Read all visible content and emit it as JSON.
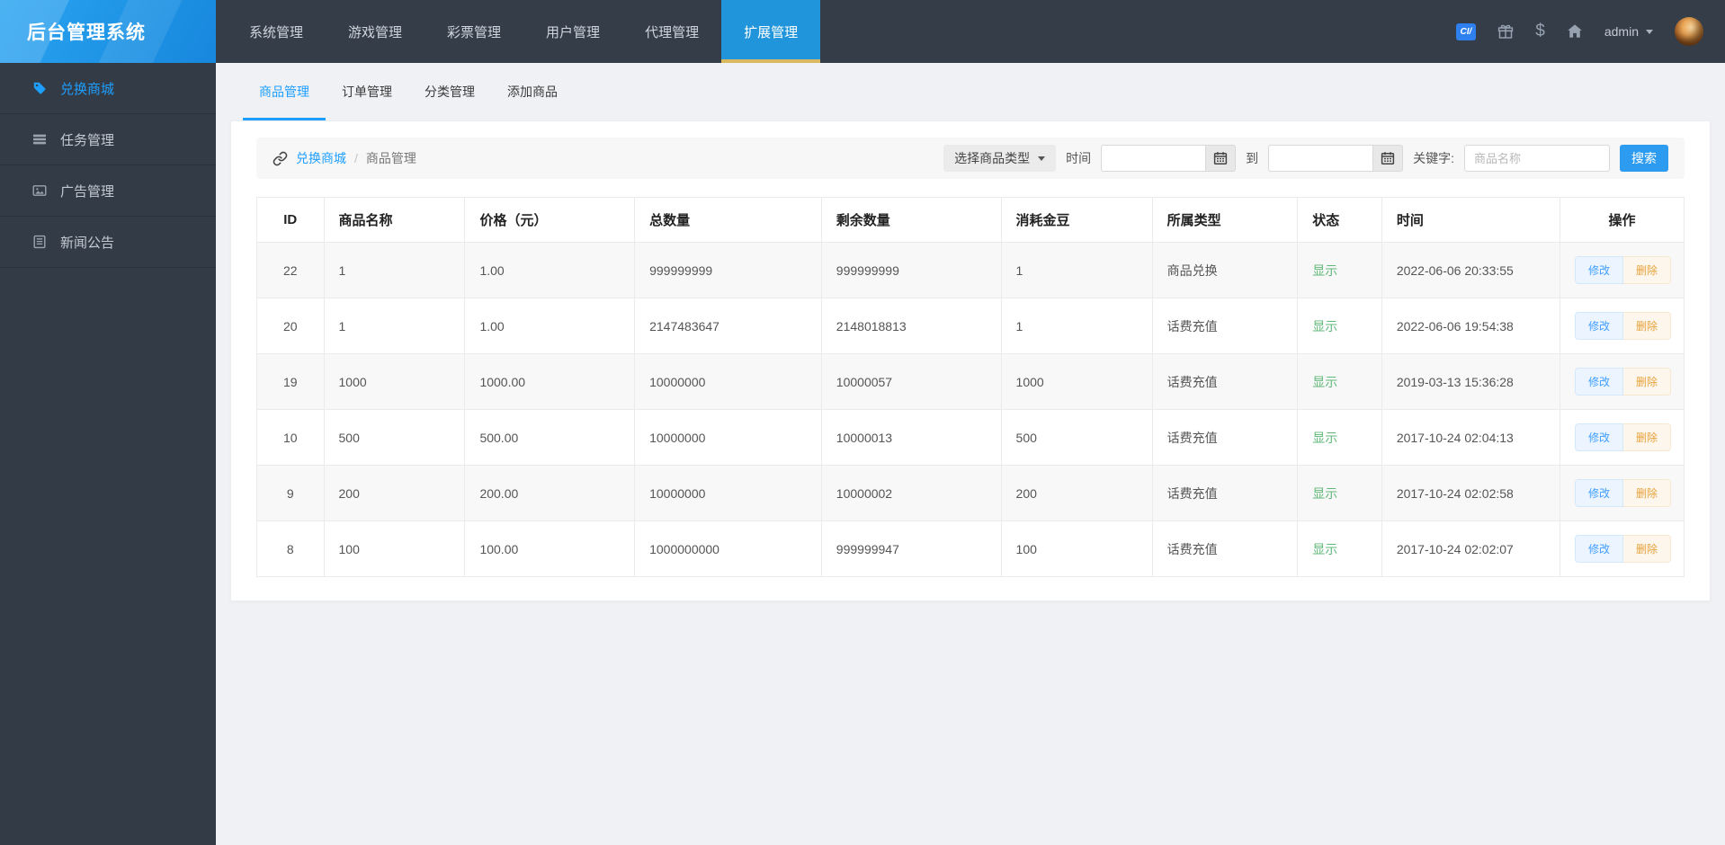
{
  "app": {
    "title": "后台管理系统"
  },
  "topnav": {
    "items": [
      {
        "label": "系统管理",
        "active": false
      },
      {
        "label": "游戏管理",
        "active": false
      },
      {
        "label": "彩票管理",
        "active": false
      },
      {
        "label": "用户管理",
        "active": false
      },
      {
        "label": "代理管理",
        "active": false
      },
      {
        "label": "扩展管理",
        "active": true
      }
    ],
    "icons": [
      {
        "name": "currency-badge-icon",
        "text": "CI/"
      },
      {
        "name": "gift-icon"
      },
      {
        "name": "dollar-icon",
        "glyph": "$"
      },
      {
        "name": "home-icon"
      }
    ],
    "user": {
      "name": "admin"
    }
  },
  "sidebar": {
    "items": [
      {
        "label": "兑换商城",
        "icon": "tag-icon",
        "active": true
      },
      {
        "label": "任务管理",
        "icon": "tasks-icon",
        "active": false
      },
      {
        "label": "广告管理",
        "icon": "image-icon",
        "active": false
      },
      {
        "label": "新闻公告",
        "icon": "news-icon",
        "active": false
      }
    ]
  },
  "tabs": {
    "items": [
      {
        "label": "商品管理",
        "active": true
      },
      {
        "label": "订单管理",
        "active": false
      },
      {
        "label": "分类管理",
        "active": false
      },
      {
        "label": "添加商品",
        "active": false
      }
    ]
  },
  "breadcrumb": {
    "icon": "link-icon",
    "separator": "/",
    "items": [
      {
        "label": "兑换商城",
        "link": true
      },
      {
        "label": "商品管理",
        "link": false
      }
    ]
  },
  "filters": {
    "type_select": {
      "label": "选择商品类型"
    },
    "time_label": "时间",
    "to_label": "到",
    "date_from": {
      "value": "",
      "icon": "calendar-icon"
    },
    "date_to": {
      "value": "",
      "icon": "calendar-icon"
    },
    "keyword_label": "关键字:",
    "keyword_input": {
      "value": "",
      "placeholder": "商品名称"
    },
    "search_button": "搜索"
  },
  "table": {
    "columns": [
      "ID",
      "商品名称",
      "价格（元）",
      "总数量",
      "剩余数量",
      "消耗金豆",
      "所属类型",
      "状态",
      "时间",
      "操作"
    ],
    "rows": [
      {
        "id": "22",
        "name": "1",
        "price": "1.00",
        "total": "999999999",
        "remaining": "999999999",
        "cost": "1",
        "type": "商品兑换",
        "status": "显示",
        "time": "2022-06-06 20:33:55"
      },
      {
        "id": "20",
        "name": "1",
        "price": "1.00",
        "total": "2147483647",
        "remaining": "2148018813",
        "cost": "1",
        "type": "话费充值",
        "status": "显示",
        "time": "2022-06-06 19:54:38"
      },
      {
        "id": "19",
        "name": "1000",
        "price": "1000.00",
        "total": "10000000",
        "remaining": "10000057",
        "cost": "1000",
        "type": "话费充值",
        "status": "显示",
        "time": "2019-03-13 15:36:28"
      },
      {
        "id": "10",
        "name": "500",
        "price": "500.00",
        "total": "10000000",
        "remaining": "10000013",
        "cost": "500",
        "type": "话费充值",
        "status": "显示",
        "time": "2017-10-24 02:04:13"
      },
      {
        "id": "9",
        "name": "200",
        "price": "200.00",
        "total": "10000000",
        "remaining": "10000002",
        "cost": "200",
        "type": "话费充值",
        "status": "显示",
        "time": "2017-10-24 02:02:58"
      },
      {
        "id": "8",
        "name": "100",
        "price": "100.00",
        "total": "1000000000",
        "remaining": "999999947",
        "cost": "100",
        "type": "话费充值",
        "status": "显示",
        "time": "2017-10-24 02:02:07"
      }
    ],
    "actions": {
      "edit": "修改",
      "delete": "删除"
    }
  },
  "colors": {
    "accent": "#1e9fff",
    "nav_active_bg": "#2095db",
    "nav_active_underline": "#d8b95f",
    "header_bg": "#353d49",
    "sidebar_bg": "#333b46",
    "status_ok": "#5fb878",
    "edit_button": "#409eff",
    "delete_button": "#e6a23c",
    "search_button_bg": "#2d9cf0"
  }
}
